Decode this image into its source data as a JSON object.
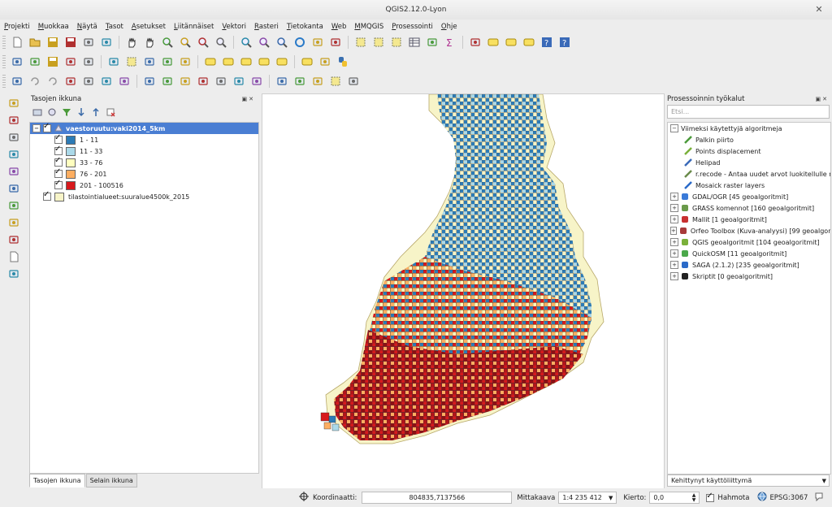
{
  "window": {
    "title": "QGIS2.12.0-Lyon"
  },
  "menu": [
    "Projekti",
    "Muokkaa",
    "Näytä",
    "Tasot",
    "Asetukset",
    "Liitännäiset",
    "Vektori",
    "Rasteri",
    "Tietokanta",
    "Web",
    "MMQGIS",
    "Prosessointi",
    "Ohje"
  ],
  "toolbar_icons": {
    "row1": [
      "new-project-icon",
      "open-project-icon",
      "save-project-icon",
      "save-as-icon",
      "print-composer-icon",
      "composer-manager-icon",
      "pan-icon",
      "pan-to-selection-icon",
      "zoom-in-icon",
      "zoom-out-icon",
      "zoom-full-icon",
      "zoom-selection-icon",
      "zoom-layer-icon",
      "zoom-last-icon",
      "zoom-next-icon",
      "refresh-icon",
      "identify-icon",
      "measure-icon",
      "select-icon",
      "deselect-icon",
      "expression-select-icon",
      "attribute-table-icon",
      "field-calculator-icon",
      "statistics-icon",
      "measure-line-icon",
      "annotation-icon",
      "text-annotation-icon",
      "label-icon",
      "help-icon",
      "whats-this-icon"
    ],
    "row2": [
      "toggle-editing-icon",
      "edit-pencil-icon",
      "save-edits-icon",
      "add-feature-icon",
      "move-feature-icon",
      "node-tool-icon",
      "delete-selected-icon",
      "cut-features-icon",
      "copy-features-icon",
      "paste-features-icon",
      "label-tool-icon",
      "pin-label-icon",
      "show-label-icon",
      "move-label-icon",
      "rotate-label-icon",
      "change-label-icon",
      "csw-icon",
      "python-icon"
    ],
    "row3": [
      "snapping-icon",
      "undo-icon",
      "redo-icon",
      "simplify-icon",
      "add-ring-icon",
      "add-part-icon",
      "fill-ring-icon",
      "delete-ring-icon",
      "delete-part-icon",
      "reshape-icon",
      "offset-curve-icon",
      "split-features-icon",
      "split-parts-icon",
      "merge-features-icon",
      "merge-attributes-icon",
      "rotate-point-icon",
      "rotate-feature-icon",
      "select-point-icon",
      "digitize-icon"
    ]
  },
  "left_toolbar_icons": [
    "add-vector-layer-icon",
    "add-raster-layer-icon",
    "add-postgis-icon",
    "add-spatialite-icon",
    "add-mssql-icon",
    "add-wms-icon",
    "add-wcs-icon",
    "add-wfs-icon",
    "add-delimited-text-icon",
    "new-shapefile-icon",
    "add-virtual-layer-icon"
  ],
  "layers_panel": {
    "title": "Tasojen ikkuna",
    "layers": [
      {
        "name": "vaestoruutu:vaki2014_5km",
        "checked": true,
        "selected": true,
        "legend": [
          {
            "label": "1 - 11",
            "color": "#2c7bb6"
          },
          {
            "label": "11 - 33",
            "color": "#abd9e9"
          },
          {
            "label": "33 - 76",
            "color": "#ffffbf"
          },
          {
            "label": "76 - 201",
            "color": "#fdae61"
          },
          {
            "label": "201 - 100516",
            "color": "#d7191c"
          }
        ]
      },
      {
        "name": "tilastointialueet:suuralue4500k_2015",
        "checked": true,
        "selected": false,
        "color": "#f7f4c8"
      }
    ]
  },
  "bottom_tabs": [
    "Tasojen ikkuna",
    "Selain ikkuna"
  ],
  "processing_panel": {
    "title": "Prosessoinnin työkalut",
    "search_placeholder": "Etsi...",
    "recent": {
      "label": "Viimeksi käytettyjä algoritmeja",
      "items": [
        "Palkin piirto",
        "Points displacement",
        "Helipad",
        "r.recode - Antaa uudet arvot luokitellulle rasterikartalle",
        "Mosaick raster layers"
      ]
    },
    "providers": [
      "GDAL/OGR [45 geoalgoritmit]",
      "GRASS komennot [160 geoalgoritmit]",
      "Mallit [1 geoalgoritmit]",
      "Orfeo Toolbox (Kuva-analyysi) [99 geoalgoritmit]",
      "QGIS geoalgoritmit [104 geoalgoritmit]",
      "QuickOSM [11 geoalgoritmit]",
      "SAGA (2.1.2) [235 geoalgoritmit]",
      "Skriptit [0 geoalgoritmit]"
    ],
    "interface_mode": "Kehittynyt käyttöliittymä"
  },
  "statusbar": {
    "coord_label": "Koordinaatti:",
    "coord_value": "804835,7137566",
    "scale_label": "Mittakaava",
    "scale_value": "1:4 235 412",
    "rotation_label": "Kierto:",
    "rotation_value": "0,0",
    "render_label": "Hahmota",
    "render_checked": true,
    "crs": "EPSG:3067"
  },
  "colors": {
    "selection": "#4a7ed3",
    "base_area": "#f7f4c8"
  }
}
